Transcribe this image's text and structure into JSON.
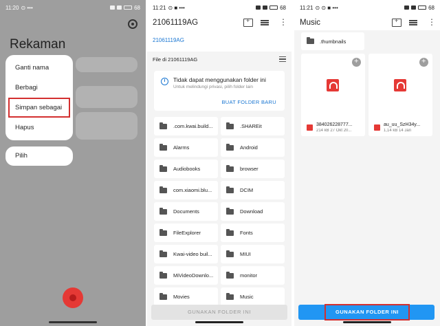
{
  "panel1": {
    "status": {
      "time": "11:20",
      "icons": "⊙ •••",
      "battery": "68"
    },
    "title": "Rekaman",
    "menu": [
      {
        "label": "Ganti nama"
      },
      {
        "label": "Berbagi"
      },
      {
        "label": "Simpan sebagai"
      },
      {
        "label": "Hapus"
      }
    ],
    "menu2": {
      "label": "Pilih"
    }
  },
  "panel2": {
    "status": {
      "time": "11:21",
      "icons": "⊙ ■ •••",
      "battery": "68"
    },
    "title": "21061119AG",
    "breadcrumb": "21061119AG",
    "file_location": "File di 21061119AG",
    "warning": {
      "title": "Tidak dapat menggunakan folder ini",
      "subtitle": "Untuk melindungi privasi, pilih folder lain",
      "action": "BUAT FOLDER BARU"
    },
    "folders": [
      {
        "name": ".com.kwai.build..."
      },
      {
        "name": ".SHAREit"
      },
      {
        "name": "Alarms"
      },
      {
        "name": "Android"
      },
      {
        "name": "Audiobooks"
      },
      {
        "name": "browser"
      },
      {
        "name": "com.xiaomi.blu..."
      },
      {
        "name": "DCIM"
      },
      {
        "name": "Documents"
      },
      {
        "name": "Download"
      },
      {
        "name": "FileExplorer"
      },
      {
        "name": "Fonts"
      },
      {
        "name": "Kwai-video buil..."
      },
      {
        "name": "MIUI"
      },
      {
        "name": "MiVideoDownlo..."
      },
      {
        "name": "monitor"
      },
      {
        "name": "Movies"
      },
      {
        "name": "Music"
      }
    ],
    "use_button": "GUNAKAN FOLDER INI"
  },
  "panel3": {
    "status": {
      "time": "11:21",
      "icons": "⊙ ⊙ ■ •••",
      "battery": "68"
    },
    "title": "Music",
    "thumb_folder": ".thumbnails",
    "files": [
      {
        "name": "384026228777...",
        "meta": "214 kB 27 Okt 20..."
      },
      {
        "name": "au_uu_SzH34y...",
        "meta": "1,14 kB 14 Jan"
      }
    ],
    "use_button": "GUNAKAN FOLDER INI"
  },
  "colors": {
    "accent": "#2196f3",
    "highlight": "#d32f2f",
    "audio": "#e53935",
    "link": "#1976d2"
  }
}
